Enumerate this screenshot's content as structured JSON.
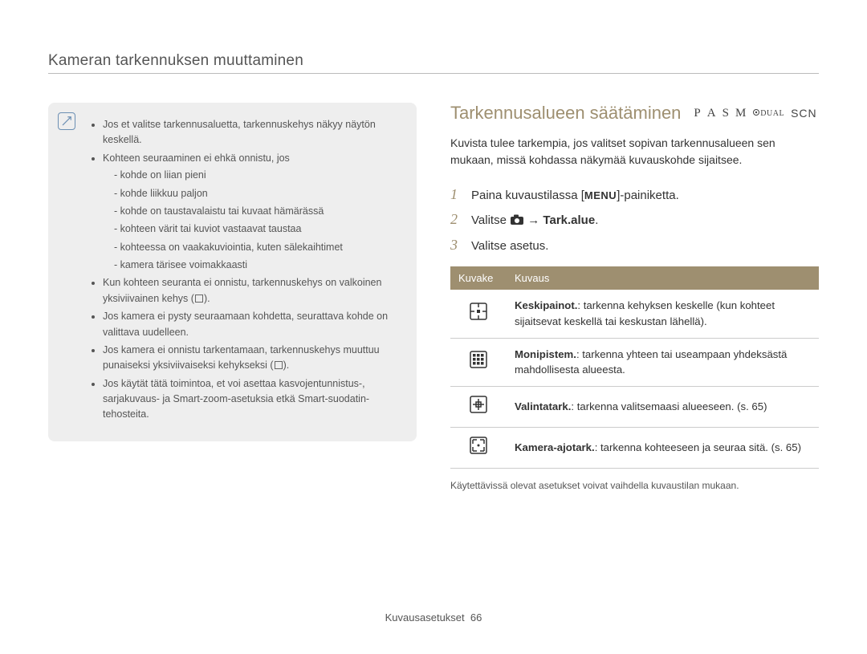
{
  "header": {
    "breadcrumb": "Kameran tarkennuksen muuttaminen"
  },
  "notebox": {
    "items": [
      {
        "text": "Jos et valitse tarkennusaluetta, tarkennuskehys näkyy näytön keskellä."
      },
      {
        "text": "Kohteen seuraaminen ei ehkä onnistu, jos",
        "sub": [
          "kohde on liian pieni",
          "kohde liikkuu paljon",
          "kohde on taustavalaistu tai kuvaat hämärässä",
          "kohteen värit tai kuviot vastaavat taustaa",
          "kohteessa on vaakakuviointia, kuten sälekaihtimet",
          "kamera tärisee voimakkaasti"
        ]
      },
      {
        "text_pre": "Kun kohteen seuranta ei onnistu, tarkennuskehys on valkoinen yksiviivainen kehys (",
        "square": true,
        "text_post": ")."
      },
      {
        "text": "Jos kamera ei pysty seuraamaan kohdetta, seurattava kohde on valittava uudelleen."
      },
      {
        "text_pre": "Jos kamera ei onnistu tarkentamaan, tarkennuskehys muuttuu punaiseksi yksiviivaiseksi kehykseksi (",
        "square": true,
        "text_post": ")."
      },
      {
        "text": "Jos käytät tätä toimintoa, et voi asettaa kasvojentunnistus-, sarjakuvaus- ja Smart-zoom-asetuksia etkä Smart-suodatin-tehosteita."
      }
    ]
  },
  "section": {
    "title": "Tarkennusalueen säätäminen",
    "modes": [
      "P",
      "A",
      "S",
      "M",
      "DUAL",
      "SCN"
    ],
    "intro": "Kuvista tulee tarkempia, jos valitset sopivan tarkennusalueen sen mukaan, missä kohdassa näkymää kuvauskohde sijaitsee."
  },
  "steps": [
    {
      "num": "1",
      "pre": "Paina kuvaustilassa [",
      "chip": "MENU",
      "post": "]-painiketta."
    },
    {
      "num": "2",
      "pre": "Valitse ",
      "camera": true,
      "arrow": " → ",
      "bold": "Tark.alue",
      "post": "."
    },
    {
      "num": "3",
      "pre": "Valitse asetus."
    }
  ],
  "table": {
    "headers": {
      "icon": "Kuvake",
      "desc": "Kuvaus"
    },
    "rows": [
      {
        "icon": "center",
        "title": "Keskipainot.",
        "desc": ": tarkenna kehyksen keskelle (kun kohteet sijaitsevat keskellä tai keskustan lähellä)."
      },
      {
        "icon": "multi",
        "title": "Monipistem.",
        "desc": ": tarkenna yhteen tai useampaan yhdeksästä mahdollisesta alueesta."
      },
      {
        "icon": "select",
        "title": "Valintatark.",
        "desc": ": tarkenna valitsemaasi alueeseen. (s. 65)"
      },
      {
        "icon": "track",
        "title": "Kamera-ajotark.",
        "desc": ": tarkenna kohteeseen ja seuraa sitä. (s. 65)"
      }
    ],
    "footnote": "Käytettävissä olevat asetukset voivat vaihdella kuvaustilan mukaan."
  },
  "footer": {
    "section": "Kuvausasetukset",
    "page": "66"
  }
}
